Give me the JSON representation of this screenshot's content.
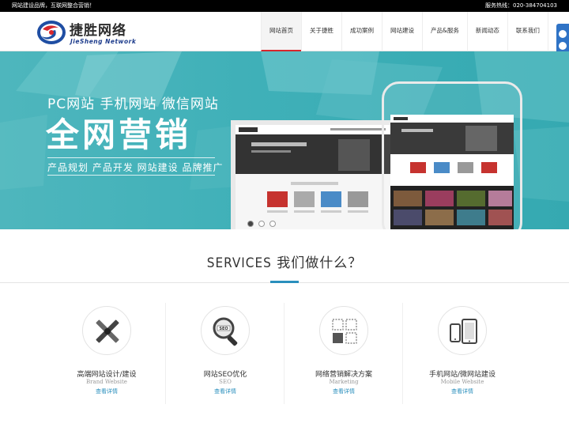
{
  "topbar": {
    "slogan": "网站建设品牌，互联网整合营销！",
    "hotline": "服务热线：020-384704103"
  },
  "logo": {
    "cn": "捷胜网络",
    "en": "JieSheng Network"
  },
  "nav": {
    "items": [
      "网站首页",
      "关于捷胜",
      "成功案例",
      "网站建设",
      "产品&服务",
      "新闻动态",
      "联系我们"
    ],
    "active": "网站首页"
  },
  "banner": {
    "line1": "PC网站  手机网站  微信网站",
    "line2": "全网营销",
    "line3": "产品规划  产品开发  网站建设  品牌推广"
  },
  "services": {
    "title_en": "SERVICES",
    "title_cn": "我们做什么？",
    "items": [
      {
        "name": "高端网站设计/建设",
        "en": "Brand Website",
        "link": "查看详情",
        "icon": "design-tools-icon"
      },
      {
        "name": "网站SEO优化",
        "en": "SEO",
        "link": "查看详情",
        "icon": "seo-magnifier-icon"
      },
      {
        "name": "网络营销解决方案",
        "en": "Marketing",
        "link": "查看详情",
        "icon": "marketing-grid-icon"
      },
      {
        "name": "手机网站/微网站建设",
        "en": "Mobile Website",
        "link": "查看详情",
        "icon": "mobile-devices-icon"
      }
    ]
  },
  "colors": {
    "accent": "#2a8fbd",
    "nav_active_border": "#d8262c",
    "banner_bg": "#3fb0b8",
    "side_float": "#2f73c6"
  }
}
